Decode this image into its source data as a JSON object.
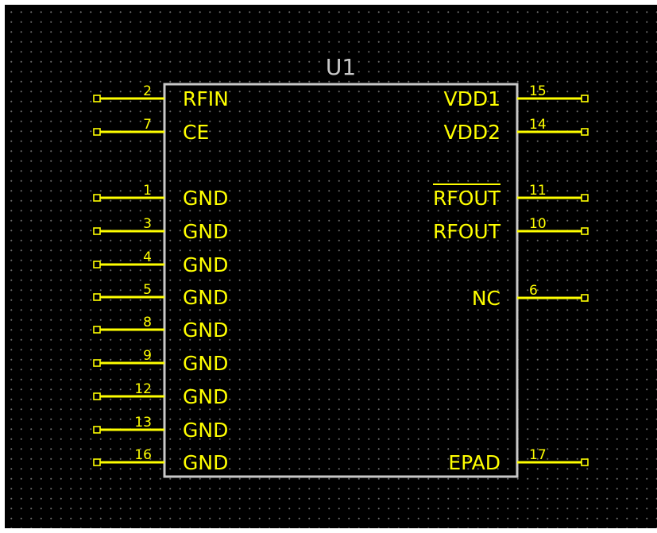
{
  "component": {
    "reference": "U1",
    "left_pins": [
      {
        "number": "2",
        "name": "RFIN"
      },
      {
        "number": "7",
        "name": "CE"
      },
      {
        "number": "1",
        "name": "GND"
      },
      {
        "number": "3",
        "name": "GND"
      },
      {
        "number": "4",
        "name": "GND"
      },
      {
        "number": "5",
        "name": "GND"
      },
      {
        "number": "8",
        "name": "GND"
      },
      {
        "number": "9",
        "name": "GND"
      },
      {
        "number": "12",
        "name": "GND"
      },
      {
        "number": "13",
        "name": "GND"
      },
      {
        "number": "16",
        "name": "GND"
      }
    ],
    "right_pins": [
      {
        "number": "15",
        "name": "VDD1"
      },
      {
        "number": "14",
        "name": "VDD2"
      },
      {
        "number": "11",
        "name": "RFOUT",
        "active_low": true
      },
      {
        "number": "10",
        "name": "RFOUT"
      },
      {
        "number": "6",
        "name": "NC"
      },
      {
        "number": "17",
        "name": "EPAD"
      }
    ]
  },
  "colors": {
    "background": "#000000",
    "grid_dot": "#6a6a6a",
    "pin": "#ffff00",
    "body_outline": "#c8c8c8"
  }
}
